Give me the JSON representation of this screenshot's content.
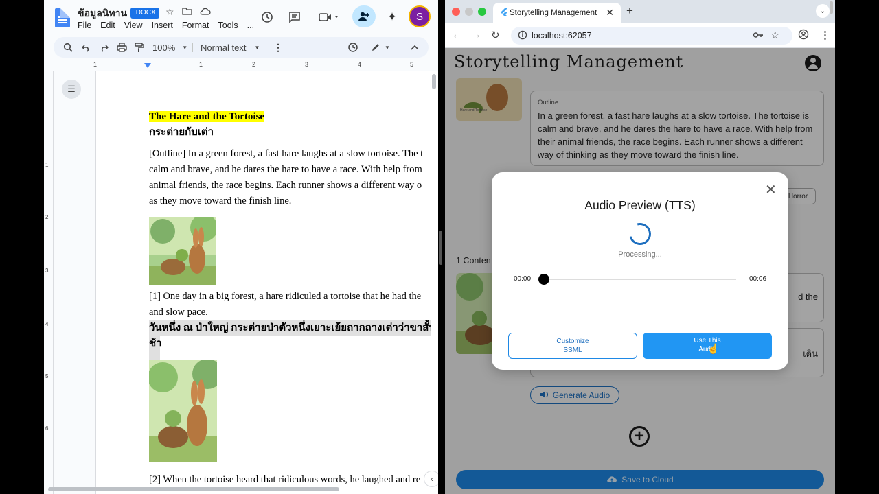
{
  "gdocs": {
    "title": "ข้อมูลนิทาน",
    "badge": ".DOCX",
    "menu": [
      "File",
      "Edit",
      "View",
      "Insert",
      "Format",
      "Tools",
      "..."
    ],
    "avatar_letter": "S",
    "toolbar": {
      "zoom": "100%",
      "style": "Normal text"
    },
    "ruler_numbers": [
      "1",
      "1",
      "2",
      "3",
      "4",
      "5"
    ],
    "vruler_numbers": [
      "1",
      "2",
      "3",
      "4",
      "5",
      "6"
    ],
    "doc": {
      "title_en": "The Hare and the Tortoise",
      "title_th": "กระต่ายกับเต่า",
      "outline_lines": [
        "[Outline] In a green forest, a fast hare laughs at a slow tortoise. The t",
        "calm and brave, and he dares the hare to have a race. With help from",
        "animal friends, the race begins. Each runner shows a different way o",
        "as they move toward the finish line."
      ],
      "p1_line1": "[1] One day in a big forest, a hare ridiculed a tortoise that he had the",
      "p1_line2": "and slow pace.",
      "p1_thai_1": "วันหนึ่ง ณ ป่าใหญ่ กระต่ายป่าตัวหนึ่งเยาะเย้ยถากถางเต่าว่าขาสั้นแล",
      "p1_thai_2": "ช้า",
      "p2_line1": "[2] When the tortoise heard that ridiculous words, he laughed and re"
    }
  },
  "chrome": {
    "tab_title": "Storytelling Management",
    "url": "localhost:62057"
  },
  "app": {
    "title": "Storytelling Management",
    "outline_label": "Outline",
    "outline_text": "In a green forest, a fast hare laughs at a slow tortoise. The tortoise is calm and brave, and he dares the hare to have a race. With help from their animal friends, the race begins. Each runner shows a different way of thinking as they move toward the finish line.",
    "chip_label": "Horror",
    "content_label": "1 Conten",
    "box2_text": "d the",
    "box3_text": "เดิน",
    "generate_audio": "Generate Audio",
    "save_cloud": "Save to Cloud",
    "thumb_caption": "Hare and Tortoise"
  },
  "modal": {
    "title": "Audio Preview (TTS)",
    "processing": "Processing...",
    "time_start": "00:00",
    "time_end": "00:06",
    "progress": 0.0,
    "customize_line1": "Customize",
    "customize_line2": "SSML",
    "use_line1": "Use This",
    "use_line2": "Audio"
  },
  "colors": {
    "docs_blue": "#4285f4",
    "highlight_yellow": "#ffff00",
    "app_primary": "#2196f3",
    "app_dim": "rgba(0,0,0,0.34)"
  },
  "icons": [
    "docs-logo-icon",
    "star-icon",
    "folder-move-icon",
    "cloud-icon",
    "history-icon",
    "comment-icon",
    "video-icon",
    "share-person-icon",
    "gemini-icon",
    "search-icon",
    "undo-icon",
    "redo-icon",
    "print-icon",
    "paint-format-icon",
    "menu-dots-icon",
    "edit-mode-icon",
    "collapse-icon",
    "outline-list-icon",
    "close-icon",
    "back-icon",
    "forward-icon",
    "reload-icon",
    "info-icon",
    "key-icon",
    "profile-icon",
    "plus-circle-icon",
    "speaker-icon",
    "cloud-upload-icon"
  ]
}
